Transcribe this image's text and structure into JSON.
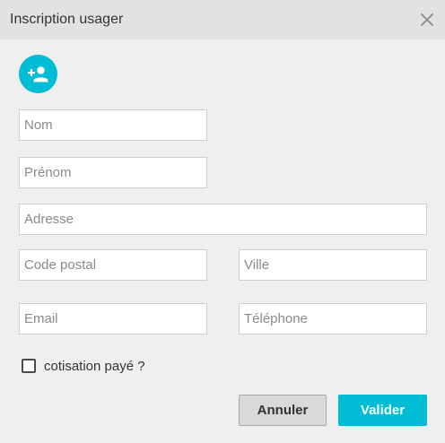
{
  "dialog": {
    "title": "Inscription usager",
    "close_icon": "close-icon",
    "avatar_icon": "person-add-icon"
  },
  "form": {
    "nom": {
      "placeholder": "Nom",
      "value": ""
    },
    "prenom": {
      "placeholder": "Prénom",
      "value": ""
    },
    "adresse": {
      "placeholder": "Adresse",
      "value": ""
    },
    "code_postal": {
      "placeholder": "Code postal",
      "value": ""
    },
    "ville": {
      "placeholder": "Ville",
      "value": ""
    },
    "email": {
      "placeholder": "Email",
      "value": ""
    },
    "telephone": {
      "placeholder": "Téléphone",
      "value": ""
    },
    "cotisation": {
      "label": "cotisation payé ?",
      "checked": false
    }
  },
  "actions": {
    "cancel_label": "Annuler",
    "validate_label": "Valider"
  },
  "colors": {
    "accent": "#00bcd4",
    "titlebar": "#e2e2e2",
    "background": "#efefef"
  }
}
